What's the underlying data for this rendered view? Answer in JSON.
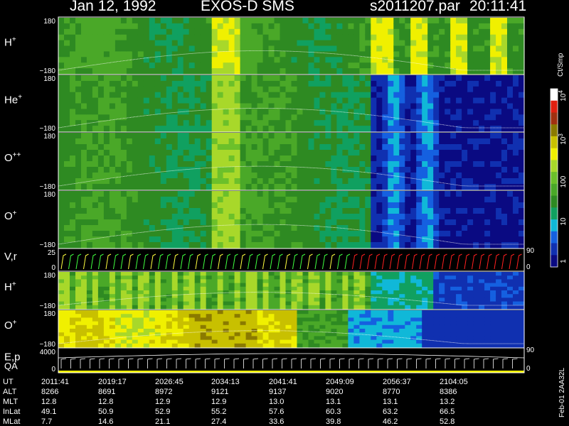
{
  "header": {
    "date": "Jan 12, 1992",
    "instrument": "EXOS-D SMS",
    "file": "s2011207.par",
    "time": "20:11:41"
  },
  "side_labels": {
    "units": "Ct/Smp",
    "footer": "Feb-01 2AA32L"
  },
  "colors": {
    "background": "#000000",
    "foreground": "#ffffff",
    "velocity_trace": "#ff2020",
    "velocity_trace_alt": "#40ff40",
    "qa_bar": "#ffff00"
  },
  "chart_data": {
    "type": "heatmap",
    "time_axis_labels": [
      "2011:41",
      "2019:17",
      "2026:45",
      "2034:13",
      "2041:41",
      "2049:09",
      "2056:37",
      "2104:05"
    ],
    "panels": [
      {
        "id": "h-plus-1",
        "label": "H",
        "sup": "+",
        "ymax": "180",
        "ymin": "−180",
        "profile": "h1"
      },
      {
        "id": "he-plus",
        "label": "He",
        "sup": "+",
        "ymax": "180",
        "ymin": "−180",
        "profile": "he"
      },
      {
        "id": "o-plus-plus",
        "label": "O",
        "sup": "++",
        "ymax": "180",
        "ymin": "−180",
        "profile": "opp"
      },
      {
        "id": "o-plus-1",
        "label": "O",
        "sup": "+",
        "ymax": "180",
        "ymin": "−180",
        "profile": "op"
      },
      {
        "id": "vr",
        "label": "V,r",
        "sup": "",
        "ymax": "25",
        "ymin": "0",
        "rmax": "90",
        "rmin": "0"
      },
      {
        "id": "h-plus-2",
        "label": "H",
        "sup": "+",
        "ymax": "180",
        "ymin": "−180",
        "profile": "h2"
      },
      {
        "id": "o-plus-2",
        "label": "O",
        "sup": "+",
        "ymax": "180",
        "ymin": "−180",
        "profile": "o2"
      },
      {
        "id": "ep-qa",
        "label": "E,p",
        "label2": "QA",
        "ymax": "4000",
        "ymin": "0",
        "rmax": "90",
        "rmin": "0"
      }
    ],
    "colorbar": {
      "label_1e4": "10",
      "sup_1e4": "4",
      "label_1e3": "10",
      "sup_1e3": "3",
      "label_100": "100",
      "label_10": "10",
      "label_1": "1"
    },
    "ephemeris": [
      {
        "name": "UT",
        "values": [
          "2011:41",
          "2019:17",
          "2026:45",
          "2034:13",
          "2041:41",
          "2049:09",
          "2056:37",
          "2104:05"
        ]
      },
      {
        "name": "ALT",
        "values": [
          "8266",
          "8691",
          "8972",
          "9121",
          "9137",
          "9020",
          "8770",
          "8386"
        ]
      },
      {
        "name": "MLT",
        "values": [
          "12.8",
          "12.8",
          "12.9",
          "12.9",
          "13.0",
          "13.1",
          "13.1",
          "13.2"
        ]
      },
      {
        "name": "InLat",
        "values": [
          "49.1",
          "50.9",
          "52.9",
          "55.2",
          "57.6",
          "60.3",
          "63.2",
          "66.5"
        ]
      },
      {
        "name": "MLat",
        "values": [
          "7.7",
          "14.6",
          "21.1",
          "27.4",
          "33.6",
          "39.8",
          "46.2",
          "52.8"
        ]
      }
    ]
  }
}
